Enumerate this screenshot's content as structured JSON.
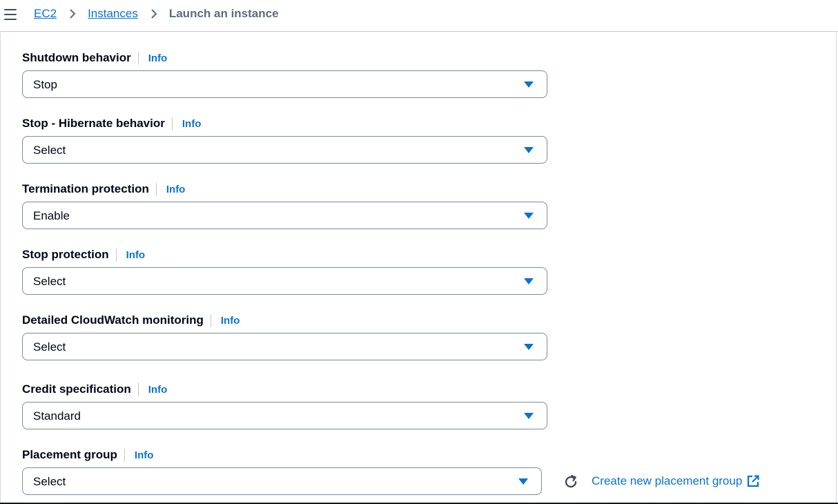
{
  "breadcrumb": {
    "items": [
      {
        "label": "EC2"
      },
      {
        "label": "Instances"
      }
    ],
    "current": "Launch an instance"
  },
  "icons": {
    "menu": "hamburger-menu-icon",
    "separator": "chevron-right-icon",
    "caret": "caret-down-icon",
    "refresh": "refresh-icon",
    "external": "external-link-icon"
  },
  "colors": {
    "link": "#0972d3",
    "text": "#000716",
    "border": "#7d8998"
  },
  "fields": {
    "shutdown": {
      "label": "Shutdown behavior",
      "info": "Info",
      "value": "Stop"
    },
    "hibernate": {
      "label": "Stop - Hibernate behavior",
      "info": "Info",
      "value": "Select"
    },
    "termination": {
      "label": "Termination protection",
      "info": "Info",
      "value": "Enable"
    },
    "stop_protection": {
      "label": "Stop protection",
      "info": "Info",
      "value": "Select"
    },
    "cloudwatch": {
      "label": "Detailed CloudWatch monitoring",
      "info": "Info",
      "value": "Select"
    },
    "credit": {
      "label": "Credit specification",
      "info": "Info",
      "value": "Standard"
    },
    "placement": {
      "label": "Placement group",
      "info": "Info",
      "value": "Select"
    }
  },
  "placement_actions": {
    "create_label": "Create new placement group"
  }
}
